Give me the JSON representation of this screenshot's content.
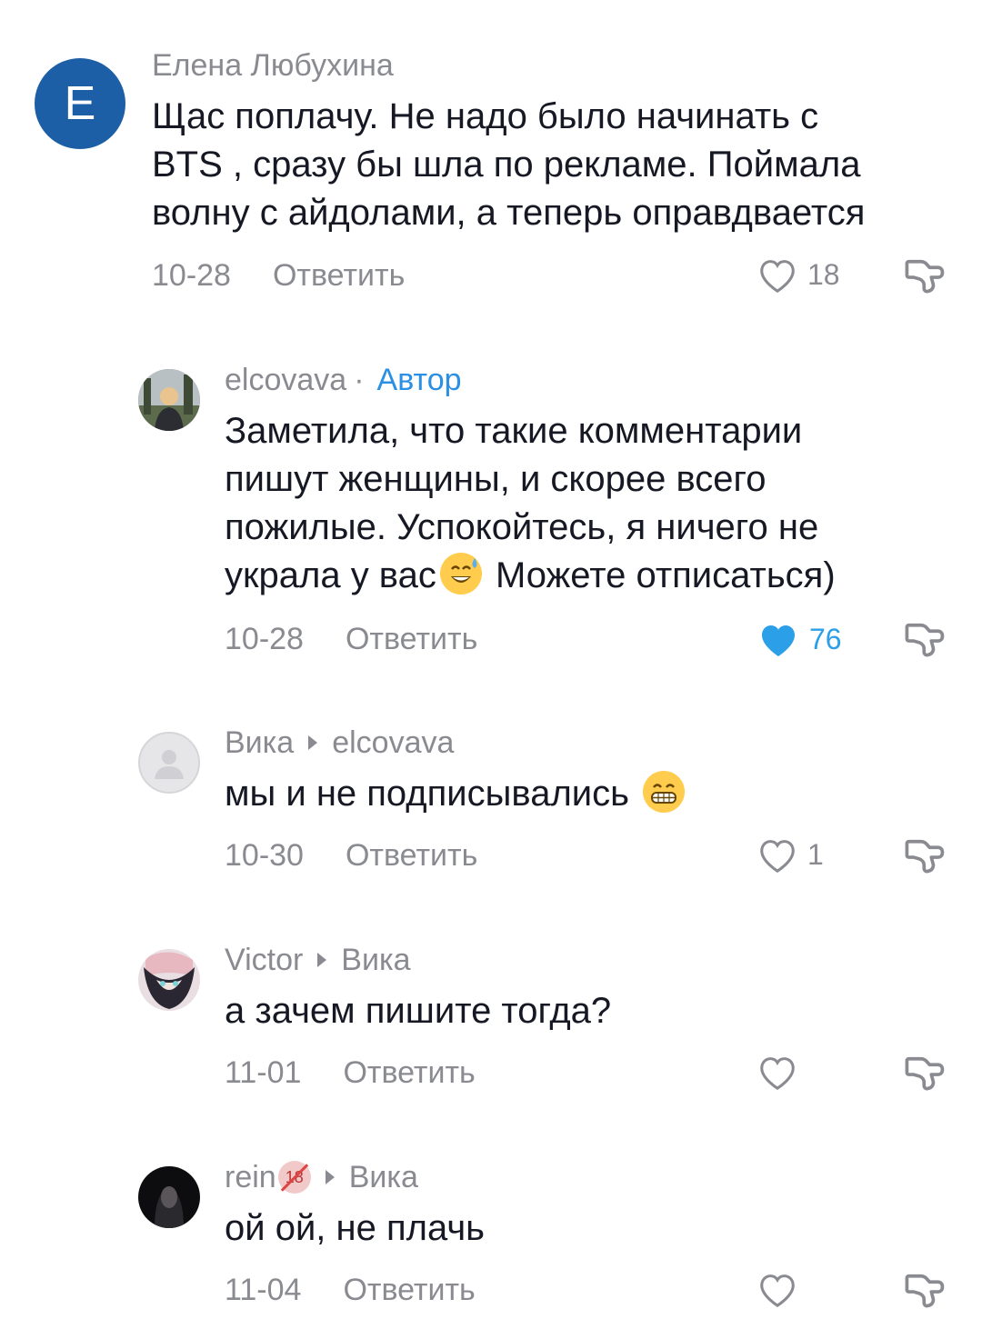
{
  "comments": [
    {
      "author": "Елена Любухина",
      "avatar_letter": "E",
      "text_lines": [
        "Щас поплачу. Не надо было начинать с",
        "BTS , сразу бы шла по рекламе. Поймала",
        "волну с айдолами, а теперь оправдвается"
      ],
      "date": "10-28",
      "reply": "Ответить",
      "likes": "18",
      "liked": false
    },
    {
      "author": "elcovava",
      "author_tag": "Автор",
      "text_lines": [
        "Заметила, что такие комментарии",
        "пишут женщины, и скорее всего",
        "пожилые. Успокойтесь, я ничего не"
      ],
      "text_last_before_emoji": "украла у вас",
      "text_last_after_emoji": " Можете отписаться)",
      "date": "10-28",
      "reply": "Ответить",
      "likes": "76",
      "liked": true
    },
    {
      "author": "Вика",
      "reply_to": "elcovava",
      "text": "мы и не подписывались ",
      "date": "10-30",
      "reply": "Ответить",
      "likes": "1",
      "liked": false
    },
    {
      "author": "Victor",
      "reply_to": "Вика",
      "text": "а зачем пишите тогда?",
      "date": "11-01",
      "reply": "Ответить",
      "likes": "",
      "liked": false
    },
    {
      "author": "rein",
      "badge": "18",
      "reply_to": "Вика",
      "text": "ой ой, не плачь",
      "date": "11-04",
      "reply": "Ответить",
      "likes": "",
      "liked": false
    }
  ],
  "icons": {
    "like": "heart-outline-icon",
    "liked": "heart-filled-icon",
    "dislike": "thumbs-down-icon",
    "reply_arrow": "reply-to-triangle-icon"
  },
  "colors": {
    "liked": "#2b9fe8",
    "author_tag": "#2b8fe3",
    "meta": "#8a8b91",
    "text": "#161823",
    "avatar_letter_bg": "#1d5fa6"
  }
}
